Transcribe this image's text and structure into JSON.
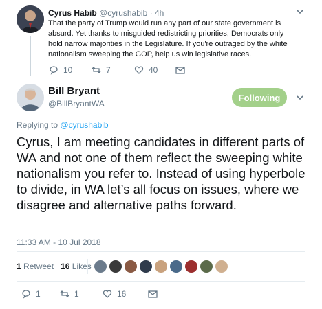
{
  "parent_tweet": {
    "display_name": "Cyrus Habib",
    "handle": "@cyrushabib",
    "separator": "·",
    "time_ago": "4h",
    "text": "That the party of Trump would run any part of our state government is absurd. Yet thanks to misguided redistricting priorities, Democrats only hold narrow majorities in the Legislature. If you're outraged by the white nationalism sweeping the GOP, help us win legislative races.",
    "replies": "10",
    "retweets": "7",
    "likes": "40"
  },
  "main_tweet": {
    "display_name": "Bill Bryant",
    "handle": "@BillBryantWA",
    "follow_label": "Following",
    "replying_prefix": "Replying to",
    "replying_to": "@cyrushabib",
    "text": "Cyrus, I am meeting candidates in different parts of WA and not one of them reflect the sweeping white nationalism you refer to. Instead of using hyperbole to divide, in WA let’s all focus on issues, where we disagree and alternative paths forward.",
    "timestamp": "11:33 AM - 10 Jul 2018",
    "retweet_count": "1",
    "retweet_label": "Retweet",
    "like_count": "16",
    "like_label": "Likes",
    "replies": "1",
    "retweets": "1",
    "likes": "16"
  },
  "likers_avatar_colors": [
    "#6b7b8c",
    "#3a3a3a",
    "#8a5a44",
    "#2f3b4c",
    "#c9a27e",
    "#4a6a8a",
    "#9c2f2f",
    "#5b6b4a",
    "#d0b090"
  ],
  "colors": {
    "accent": "#1da1f2",
    "following_button": "#a3d08a",
    "muted_text": "#657786"
  }
}
